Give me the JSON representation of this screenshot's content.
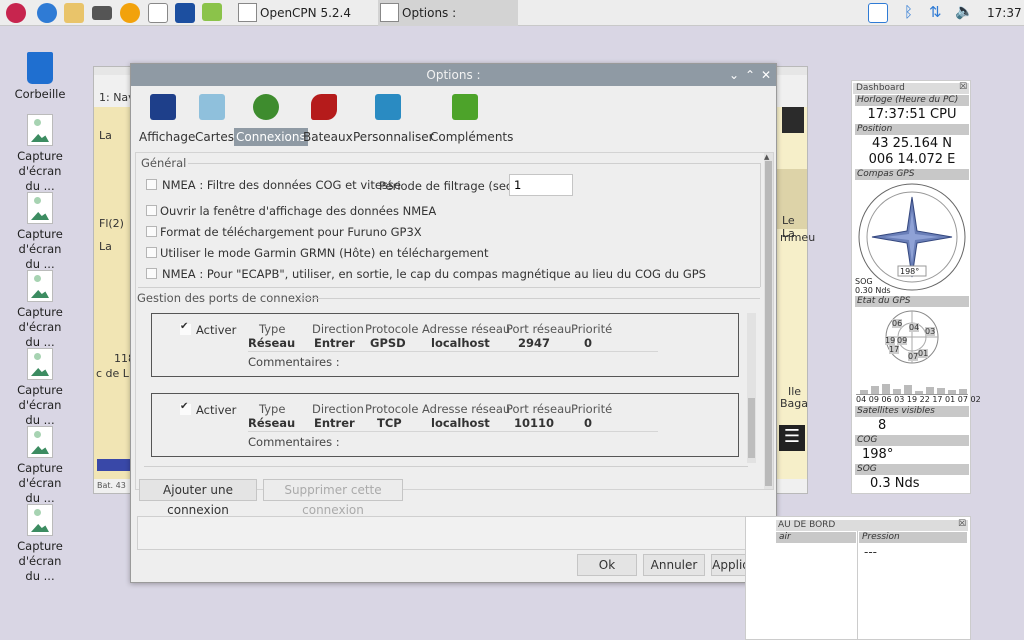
{
  "taskbar": {
    "tasks": [
      "OpenCPN 5.2.4",
      "Options :"
    ],
    "clock": "17:37"
  },
  "desktop": {
    "icons": [
      "Corbeille",
      "Capture d'écran du ...",
      "Capture d'écran du ...",
      "Capture d'écran du ...",
      "Capture d'écran du ...",
      "Capture d'écran du ...",
      "Capture d'écran du ..."
    ]
  },
  "chart_window": {
    "title": "1: Nav",
    "labels": [
      "La",
      "Fl(2)",
      "La",
      "118",
      "c de L",
      "Ile",
      "Baga",
      "Le La",
      "mmeu",
      "Bat. 43"
    ]
  },
  "dialog": {
    "title": "Options :",
    "tabs": [
      "Affichage",
      "Cartes",
      "Connexions",
      "Bateaux",
      "Personnaliser",
      "Compléments"
    ],
    "general": {
      "group": "Général",
      "options": [
        "NMEA : Filtre des données COG et vitesse",
        "Ouvrir la fenêtre d'affichage des données NMEA",
        "Format de téléchargement pour Furuno GP3X",
        "Utiliser le mode Garmin GRMN (Hôte) en téléchargement",
        "NMEA : Pour \"ECAPB\", utiliser, en sortie, le cap du compas magnétique  au lieu du COG du GPS"
      ],
      "filter_label": "Période de filtrage (sec.)",
      "filter_value": "1"
    },
    "ports": {
      "group": "Gestion des ports de connexion",
      "headers": [
        "Type",
        "Direction",
        "Protocole",
        "Adresse réseau",
        "Port réseau",
        "Priorité"
      ],
      "enable_label": "Activer",
      "comments_label": "Commentaires :",
      "connections": [
        {
          "type": "Réseau",
          "direction": "Entrer",
          "protocol": "GPSD",
          "address": "localhost",
          "port": "2947",
          "priority": "0"
        },
        {
          "type": "Réseau",
          "direction": "Entrer",
          "protocol": "TCP",
          "address": "localhost",
          "port": "10110",
          "priority": "0"
        }
      ]
    },
    "buttons": {
      "add": "Ajouter une connexion",
      "remove": "Supprimer cette connexion",
      "ok": "Ok",
      "cancel": "Annuler",
      "apply": "Appliquer"
    }
  },
  "dashboard": {
    "title": "Dashboard",
    "clock_caption": "Horloge (Heure du PC)",
    "clock_value": "17:37:51 CPU",
    "position_caption": "Position",
    "lat": "43 25.164 N",
    "lon": "006 14.072 E",
    "compass_caption": "Compas GPS",
    "compass_heading": "198°",
    "sog_small": "SOG",
    "sog_small_value": "0.30 Nds",
    "gps_caption": "Etat du GPS",
    "sat_ids": [
      "06",
      "04",
      "03",
      "19",
      "09",
      "17",
      "07",
      "01"
    ],
    "sat_bar_labels": "04 09 06 03 19 22 17 01 07 02",
    "sats_caption": "Satellites visibles",
    "sats_value": "8",
    "cog_caption": "COG",
    "cog_value": "198°",
    "sog_caption": "SOG",
    "sog_value": "0.3 Nds"
  },
  "dashboard2": {
    "title": "AU DE BORD",
    "col1": "air",
    "col2": "Pression",
    "col2_value": "---"
  },
  "colors": {
    "dialog_title": "#8f9aa4",
    "desktop": "#d9d6e4"
  }
}
